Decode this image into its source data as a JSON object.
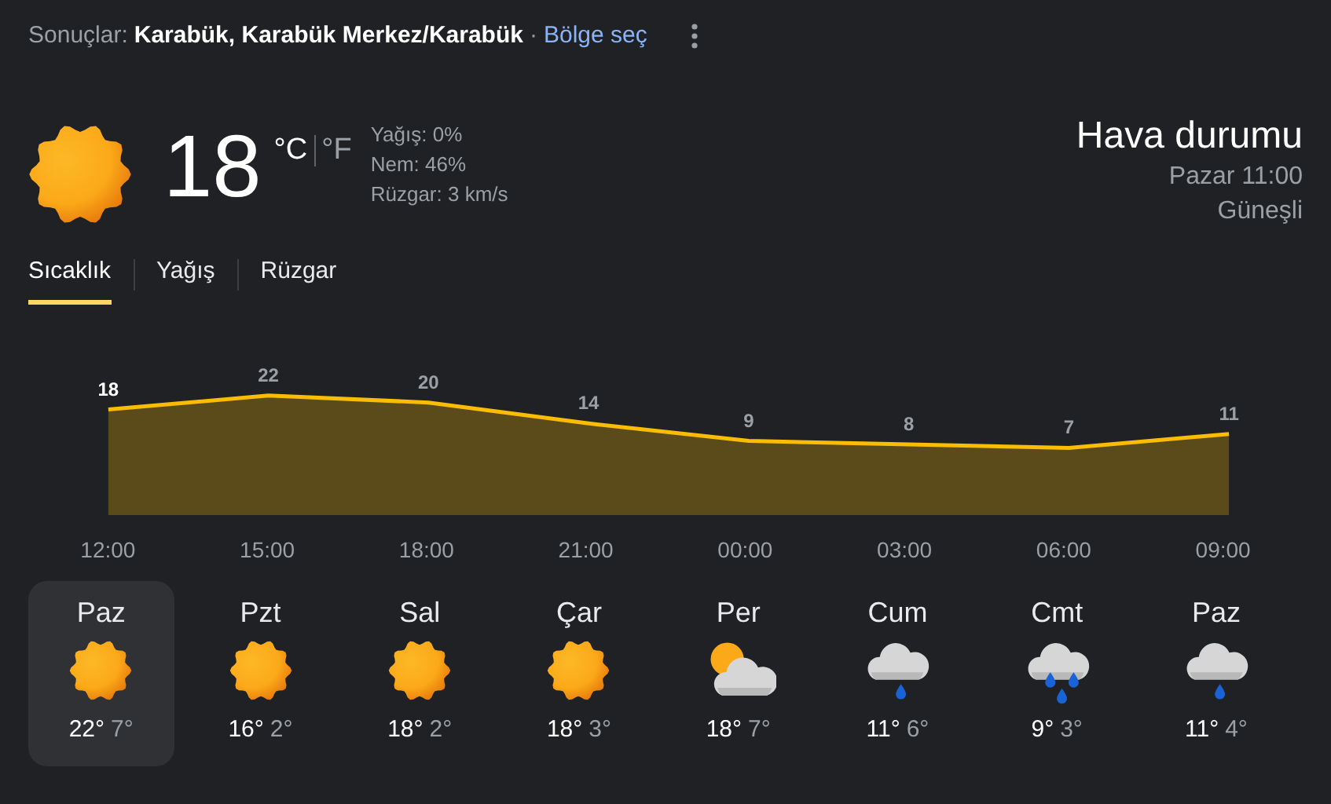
{
  "header": {
    "label": "Sonuçlar:",
    "location": "Karabük, Karabük Merkez/Karabük",
    "separator": "·",
    "link": "Bölge seç"
  },
  "current": {
    "kind": "sun",
    "temperature": "18",
    "unit_c": "°C",
    "unit_f": "°F",
    "unit_c_selected": true,
    "details": [
      "Yağış: 0%",
      "Nem: 46%",
      "Rüzgar: 3 km/s"
    ]
  },
  "summary": {
    "title": "Hava durumu",
    "time": "Pazar 11:00",
    "condition": "Güneşli"
  },
  "tabs": [
    {
      "label": "Sıcaklık",
      "selected": true
    },
    {
      "label": "Yağış",
      "selected": false
    },
    {
      "label": "Rüzgar",
      "selected": false
    }
  ],
  "chart": {
    "chart_data": {
      "type": "area",
      "categories": [
        "12:00",
        "15:00",
        "18:00",
        "21:00",
        "00:00",
        "03:00",
        "06:00",
        "09:00"
      ],
      "series": [
        {
          "color": "#fbbc04",
          "values": [
            18,
            22,
            20,
            14,
            9,
            8,
            7,
            11
          ]
        }
      ],
      "data_labels": true
    }
  },
  "days": [
    {
      "name": "Paz",
      "kind": "sun",
      "high": "22°",
      "low": "7°",
      "selected": true
    },
    {
      "name": "Pzt",
      "kind": "sun",
      "high": "16°",
      "low": "2°",
      "selected": false
    },
    {
      "name": "Sal",
      "kind": "sun",
      "high": "18°",
      "low": "2°",
      "selected": false
    },
    {
      "name": "Çar",
      "kind": "sun",
      "high": "18°",
      "low": "3°",
      "selected": false
    },
    {
      "name": "Per",
      "kind": "partly",
      "high": "18°",
      "low": "7°",
      "selected": false
    },
    {
      "name": "Cum",
      "kind": "rain",
      "high": "11°",
      "low": "6°",
      "selected": false
    },
    {
      "name": "Cmt",
      "kind": "heavy",
      "high": "9°",
      "low": "3°",
      "selected": false
    },
    {
      "name": "Paz",
      "kind": "rain",
      "high": "11°",
      "low": "4°",
      "selected": false
    }
  ]
}
